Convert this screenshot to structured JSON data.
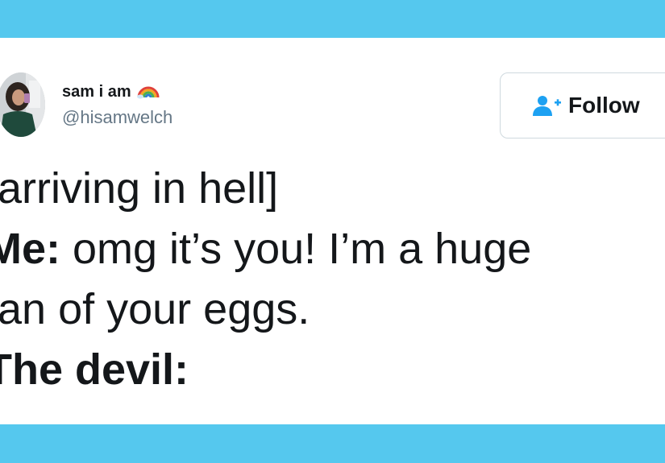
{
  "colors": {
    "band": "#55c8ee",
    "text": "#14171a",
    "muted": "#657786",
    "follow_accent": "#1da1f2"
  },
  "author": {
    "display_name": "sam i am",
    "name_emoji_icon": "rainbow-icon",
    "handle": "@hisamwelch",
    "avatar_icon": "avatar"
  },
  "follow_button": {
    "icon": "add-user-icon",
    "label": "Follow"
  },
  "tweet": {
    "line1": "[arriving in hell]",
    "line2_speaker": "Me:",
    "line2_text": " omg it’s you! I’m a huge",
    "line3": "fan of your eggs.",
    "line4_speaker": "The devil:"
  }
}
